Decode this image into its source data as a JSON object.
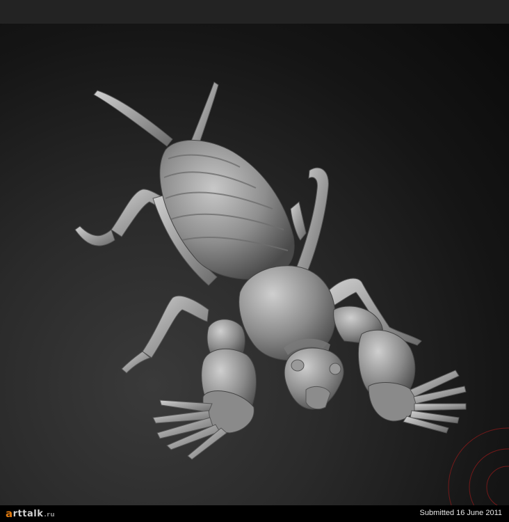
{
  "logo": {
    "first_letter": "a",
    "text": "rttalk",
    "domain": ".ru"
  },
  "footer": {
    "submitted": "Submitted 16 June 2011"
  },
  "image": {
    "subject": "grey 3D sculpt of a mole cricket",
    "background": "#1e1e1e",
    "accent": "#e07a10",
    "gizmo": "#8a1a1a"
  }
}
